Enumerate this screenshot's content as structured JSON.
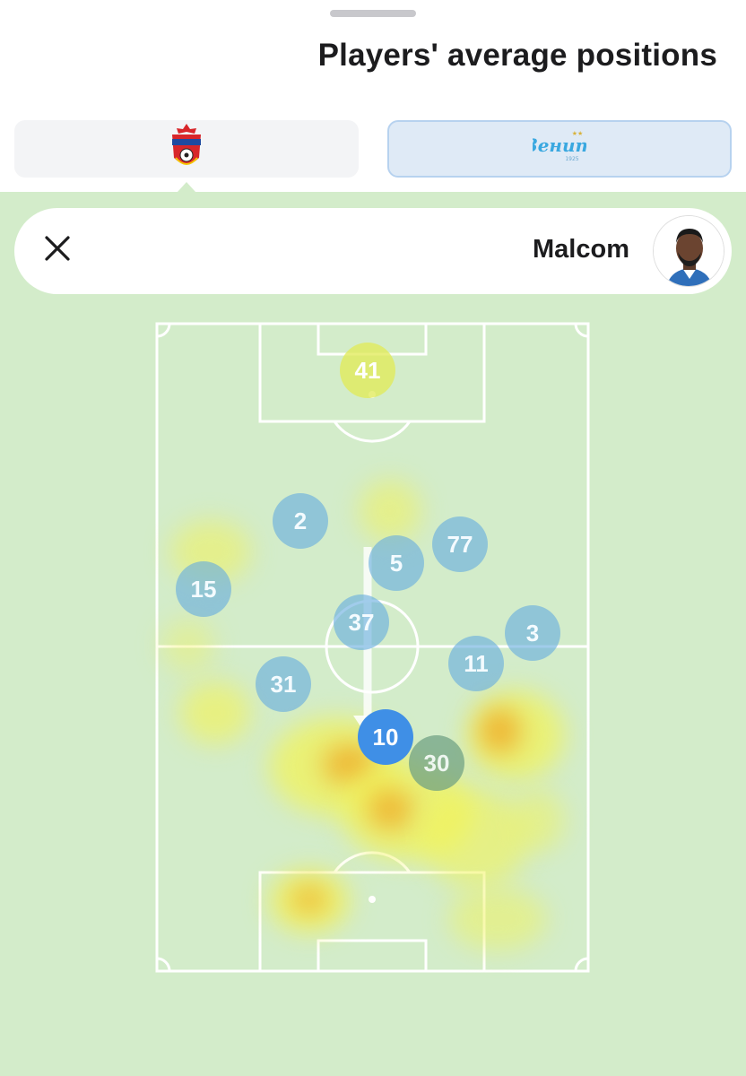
{
  "header": {
    "title": "Players' average positions"
  },
  "teams": {
    "home": {
      "name": "CSKA",
      "logo_icon": "cska-crest-icon"
    },
    "away": {
      "name": "Zenit",
      "logo_icon": "zenit-crest-icon",
      "logo_text": "Зенит",
      "logo_year": "1925",
      "selected": true
    }
  },
  "player_card": {
    "name": "Malcom",
    "close_icon": "close-icon",
    "avatar_icon": "player-photo-icon"
  },
  "pitch": {
    "players": [
      {
        "number": "41",
        "style": "gk"
      },
      {
        "number": "2",
        "style": "opp"
      },
      {
        "number": "77",
        "style": "opp"
      },
      {
        "number": "5",
        "style": "opp"
      },
      {
        "number": "15",
        "style": "opp"
      },
      {
        "number": "37",
        "style": "opp"
      },
      {
        "number": "3",
        "style": "opp"
      },
      {
        "number": "11",
        "style": "opp"
      },
      {
        "number": "31",
        "style": "opp"
      },
      {
        "number": "10",
        "style": "sel"
      },
      {
        "number": "30",
        "style": "dim"
      }
    ]
  },
  "colors": {
    "background": "#d3ecca",
    "selected_marker": "#3f8fe6",
    "heat_low": "#f2f35a",
    "heat_high": "#f0a520"
  }
}
